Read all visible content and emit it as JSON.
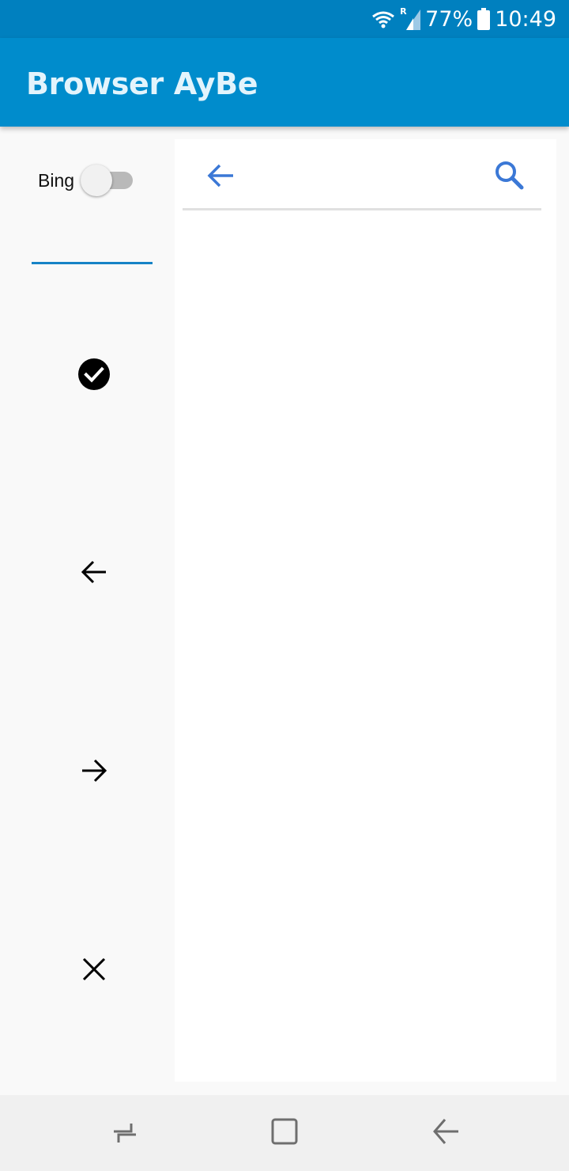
{
  "status_bar": {
    "battery": "77%",
    "time": "10:49",
    "roaming_indicator": "R",
    "icons": [
      "wifi-icon",
      "signal-icon",
      "battery-icon"
    ]
  },
  "app_bar": {
    "title": "Browser AyBe",
    "color": "#008ccc"
  },
  "sidebar": {
    "toggle_label": "Bing",
    "toggle_on": false,
    "accent_color": "#1683c6",
    "buttons": [
      "check-circle-icon",
      "arrow-back-icon",
      "arrow-forward-icon",
      "close-icon"
    ]
  },
  "panel": {
    "icons": [
      "arrow-back-icon",
      "search-icon"
    ],
    "icon_color": "#3b78d6"
  },
  "nav_bar": {
    "buttons": [
      "recent-apps-icon",
      "home-icon",
      "back-icon"
    ]
  }
}
